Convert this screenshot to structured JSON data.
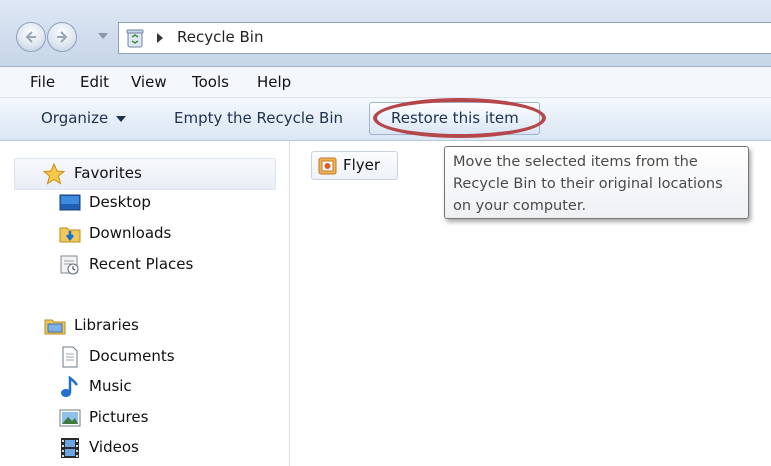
{
  "address": {
    "location": "Recycle Bin"
  },
  "menu": {
    "items": [
      "File",
      "Edit",
      "View",
      "Tools",
      "Help"
    ]
  },
  "toolbar": {
    "organize_label": "Organize",
    "empty_label": "Empty the Recycle Bin",
    "restore_label": "Restore this item"
  },
  "tooltip": {
    "text": "Move the selected items from the Recycle Bin to their original locations on your computer."
  },
  "navigation": {
    "favorites_label": "Favorites",
    "favorites": [
      "Desktop",
      "Downloads",
      "Recent Places"
    ],
    "libraries_label": "Libraries",
    "libraries": [
      "Documents",
      "Music",
      "Pictures",
      "Videos"
    ]
  },
  "files": [
    {
      "name": "Flyer"
    }
  ],
  "colors": {
    "highlight": "#b5474b",
    "toolbar_text": "#1e3250"
  },
  "icons": {
    "favorites": "star-icon",
    "desktop": "desktop-icon",
    "downloads": "downloads-folder-icon",
    "recent_places": "recent-places-icon",
    "libraries": "library-folder-icon",
    "documents": "document-icon",
    "music": "music-note-icon",
    "pictures": "pictures-icon",
    "videos": "film-icon",
    "recycle_bin": "recycle-bin-icon",
    "file": "image-file-icon"
  }
}
